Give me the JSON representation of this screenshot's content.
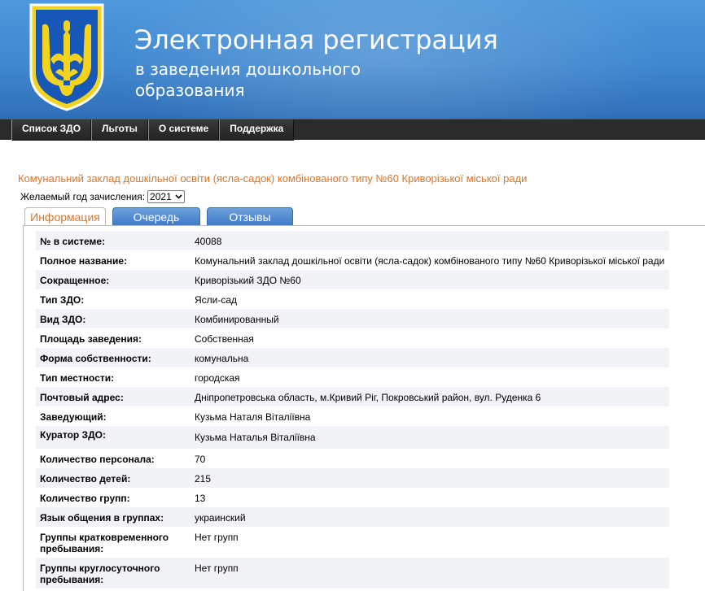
{
  "header": {
    "title": "Электронная регистрация",
    "subtitle": "в заведения дошкольного образования",
    "logo_icon": "ukraine-trident-coat-of-arms-icon"
  },
  "nav": {
    "items": [
      {
        "label": "Список ЗДО"
      },
      {
        "label": "Льготы"
      },
      {
        "label": "О системе"
      },
      {
        "label": "Поддержка"
      }
    ]
  },
  "org": {
    "title": "Комунальний заклад дошкільної освіти (ясла-садок) комбінованого типу №60 Криворізької міської ради"
  },
  "year": {
    "label": "Желаемый год зачисления:",
    "selected": "2021"
  },
  "tabs": [
    {
      "label": "Информация",
      "active": true
    },
    {
      "label": "Очередь",
      "active": false
    },
    {
      "label": "Отзывы",
      "active": false
    }
  ],
  "info": [
    {
      "key": "№ в системе:",
      "value": "40088"
    },
    {
      "key": "Полное название:",
      "value": "Комунальний заклад дошкільної освіти (ясла-садок) комбінованого типу №60 Криворізької міської ради"
    },
    {
      "key": "Сокращенное:",
      "value": "Криворізький ЗДО №60"
    },
    {
      "key": "Тип ЗДО:",
      "value": "Ясли-сад"
    },
    {
      "key": "Вид ЗДО:",
      "value": "Комбинированный"
    },
    {
      "key": "Площадь заведения:",
      "value": "Собственная"
    },
    {
      "key": "Форма собственности:",
      "value": "комунальна"
    },
    {
      "key": "Тип местности:",
      "value": "городская"
    },
    {
      "key": "Почтовый адрес:",
      "value": "Дніпропетровська область, м.Кривий Ріг, Покровський район, вул. Руденка 6"
    },
    {
      "key": "Заведующий:",
      "value": "Кузьма Наталя Віталіївна"
    },
    {
      "key": "Куратор ЗДО:",
      "value": "Кузьма Наталья Віталіївна"
    },
    {
      "key": "Количество персонала:",
      "value": "70"
    },
    {
      "key": "Количество детей:",
      "value": "215"
    },
    {
      "key": "Количество групп:",
      "value": "13"
    },
    {
      "key": "Язык общения в группах:",
      "value": "украинский"
    },
    {
      "key": "Группы кратковременного пребывания:",
      "value": "Нет групп"
    },
    {
      "key": "Группы круглосуточного пребывания:",
      "value": "Нет групп"
    }
  ],
  "colors": {
    "header_blue": "#3f87cf",
    "accent_orange": "#d8762b",
    "tab_blue": "#4a86cf",
    "nav_dark": "#2b2b2b",
    "row_stripe": "#f2f3f7"
  }
}
